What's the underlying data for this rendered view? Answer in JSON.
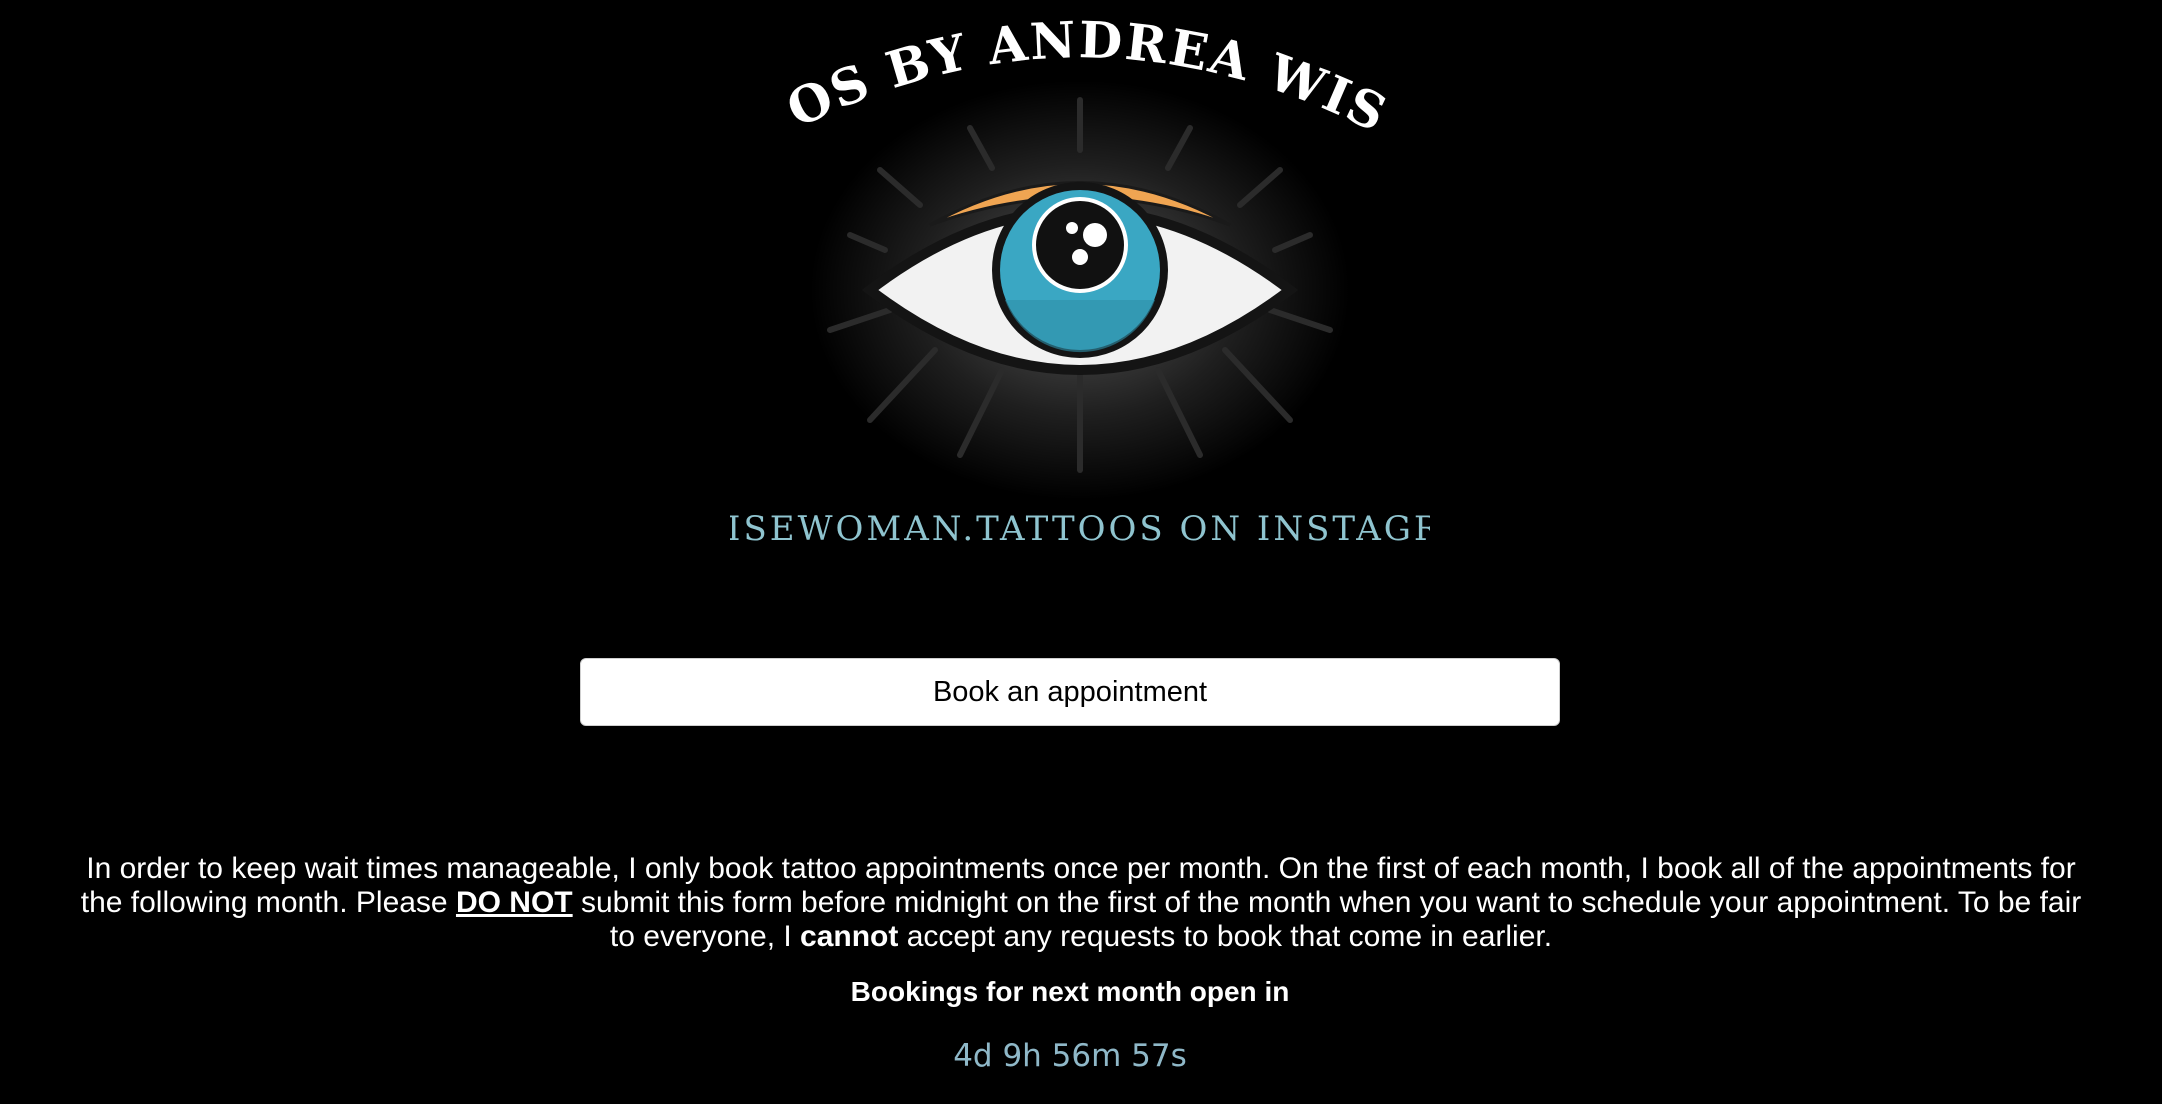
{
  "logo": {
    "title_text": "TATTOOS BY ANDREA WISEMAN",
    "handle_text": "@WISEWOMAN.TATTOOS ON INSTAGRAM",
    "colors": {
      "iris": "#3aa7c3",
      "brow": "#f0a552",
      "handle": "#8fc4cf",
      "ray": "#2b2b2b"
    }
  },
  "booking": {
    "button_label": "Book an appointment"
  },
  "notice": {
    "part1": "In order to keep wait times manageable, I only book tattoo appointments once per month. On the first of each month, I book all of the appointments for the following month. Please ",
    "emphasis1": "DO NOT",
    "part2": " submit this form before midnight on the first of the month when you want to schedule your appointment. To be fair to everyone, I ",
    "emphasis2": "cannot",
    "part3": " accept any requests to book that come in earlier."
  },
  "countdown": {
    "label": "Bookings for next month open in",
    "value": "4d 9h 56m 57s"
  }
}
